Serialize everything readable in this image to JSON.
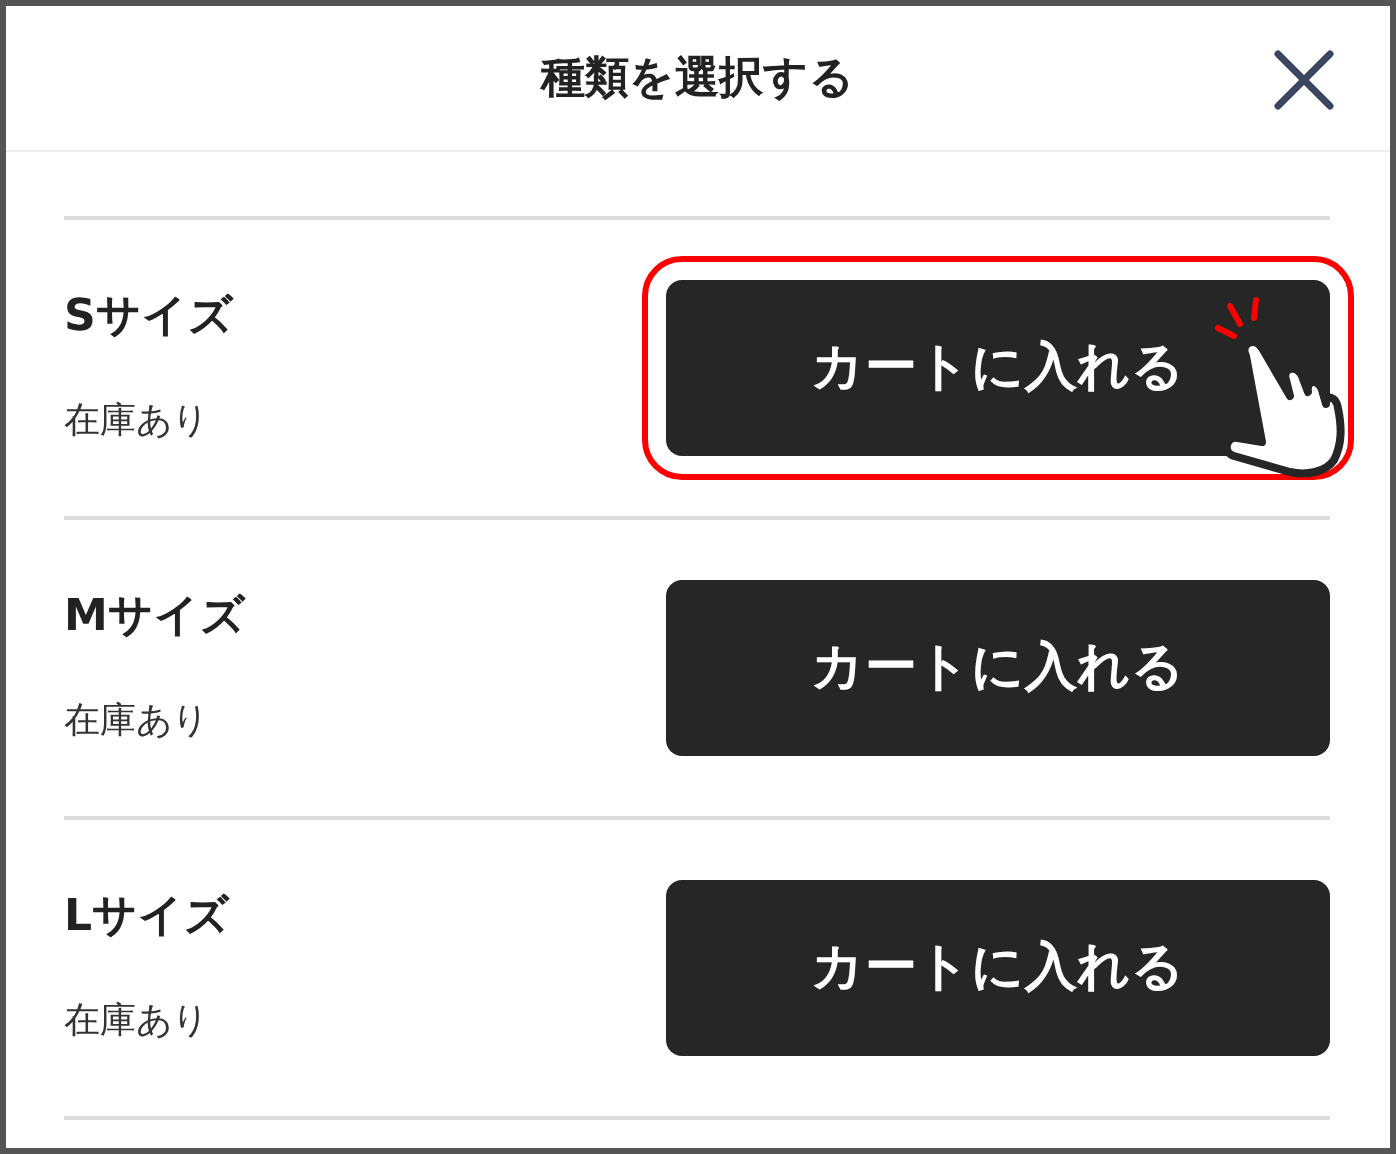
{
  "dialog": {
    "title": "種類を選択する"
  },
  "variants": [
    {
      "name": "Sサイズ",
      "stock": "在庫あり",
      "button": "カートに入れる",
      "highlighted": true
    },
    {
      "name": "Mサイズ",
      "stock": "在庫あり",
      "button": "カートに入れる",
      "highlighted": false
    },
    {
      "name": "Lサイズ",
      "stock": "在庫あり",
      "button": "カートに入れる",
      "highlighted": false
    }
  ]
}
